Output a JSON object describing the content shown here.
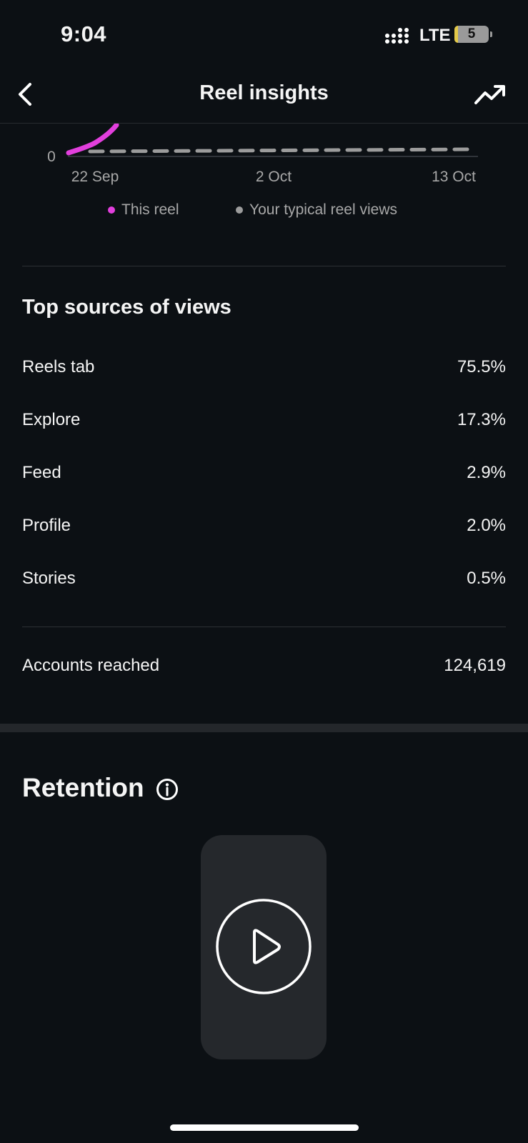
{
  "status_bar": {
    "time": "9:04",
    "network": "LTE",
    "battery_level": "5"
  },
  "header": {
    "title": "Reel insights"
  },
  "icons": {
    "back": "chevron-left-icon",
    "trend": "trending-up-icon",
    "info": "info-icon",
    "play": "play-icon"
  },
  "chart_data": {
    "type": "line",
    "x_ticks": [
      "22 Sep",
      "2 Oct",
      "13 Oct"
    ],
    "y_ticks": [
      "0"
    ],
    "series": [
      {
        "name": "This reel",
        "color": "#e23fdd",
        "style": "solid"
      },
      {
        "name": "Your typical reel views",
        "color": "#9c9c9c",
        "style": "dashed"
      }
    ]
  },
  "sources": {
    "title": "Top sources of views",
    "items": [
      {
        "label": "Reels tab",
        "value": "75.5%"
      },
      {
        "label": "Explore",
        "value": "17.3%"
      },
      {
        "label": "Feed",
        "value": "2.9%"
      },
      {
        "label": "Profile",
        "value": "2.0%"
      },
      {
        "label": "Stories",
        "value": "0.5%"
      }
    ]
  },
  "accounts_reached": {
    "label": "Accounts reached",
    "value": "124,619"
  },
  "retention": {
    "title": "Retention"
  },
  "colors": {
    "background": "#0c1014",
    "accent": "#e23fdd",
    "card": "#25282c"
  }
}
